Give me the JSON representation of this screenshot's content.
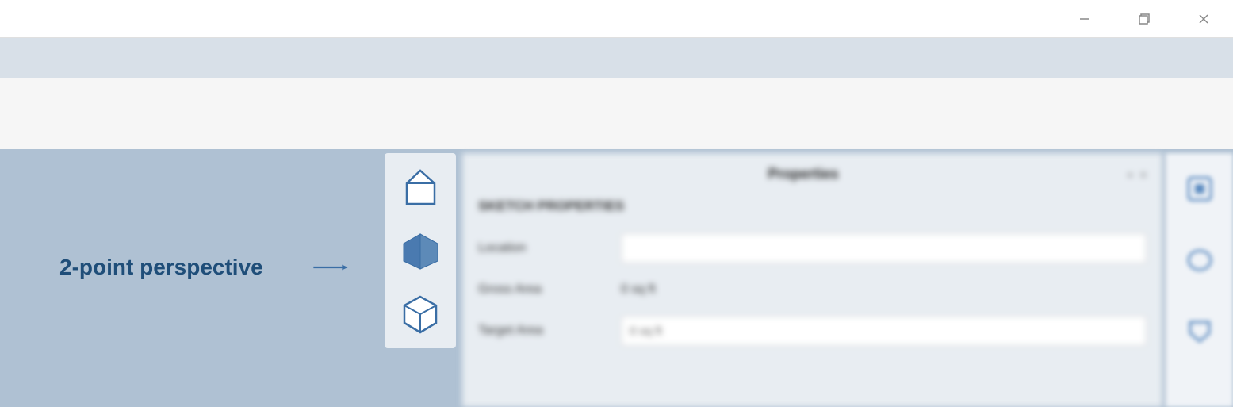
{
  "window": {
    "minimize": "−",
    "maximize": "▢",
    "close": "✕"
  },
  "annotation": {
    "label": "2-point perspective"
  },
  "perspective_modes": {
    "one_point": "1-point",
    "two_point": "2-point",
    "three_point": "3-point"
  },
  "properties_panel": {
    "title": "Properties",
    "pin": "📌",
    "close": "×",
    "section_title": "SKETCH PROPERTIES",
    "fields": {
      "location": {
        "label": "Location",
        "value": ""
      },
      "gross_area": {
        "label": "Gross Area",
        "value": "0 sq ft"
      },
      "target_area": {
        "label": "Target Area",
        "value": "0 sq ft"
      }
    }
  },
  "colors": {
    "accent": "#1f4e79",
    "canvas_bg": "#afc1d3",
    "icon_blue": "#3a6ea5",
    "icon_fill": "#4a7ab0"
  }
}
